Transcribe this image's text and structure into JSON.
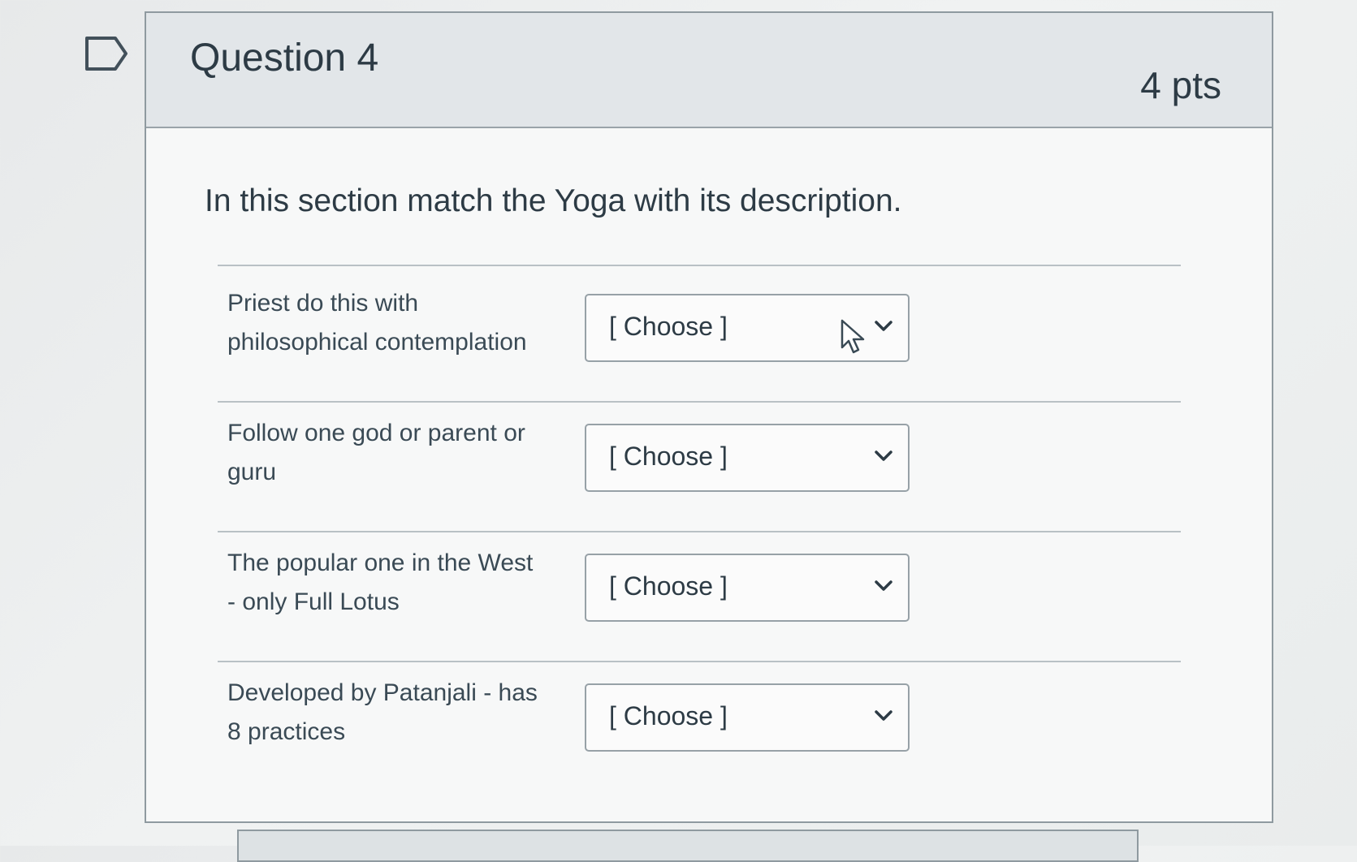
{
  "question": {
    "title": "Question 4",
    "points": "4 pts",
    "prompt": "In this section match the Yoga with its description.",
    "flag_icon": "flag-outline-icon",
    "matches": [
      {
        "label_line1": "Priest do this with",
        "label_line2": "philosophical contemplation",
        "selected": "[ Choose ]"
      },
      {
        "label_line1": "Follow one god or parent or",
        "label_line2": "guru",
        "selected": "[ Choose ]"
      },
      {
        "label_line1": "The popular one in the West",
        "label_line2": "- only Full Lotus",
        "selected": "[ Choose ]"
      },
      {
        "label_line1": "Developed by Patanjali - has",
        "label_line2": "8 practices",
        "selected": "[ Choose ]"
      }
    ]
  },
  "colors": {
    "header_bg": "#e2e6e9",
    "text": "#2d3b45",
    "border": "#97a1a7"
  }
}
